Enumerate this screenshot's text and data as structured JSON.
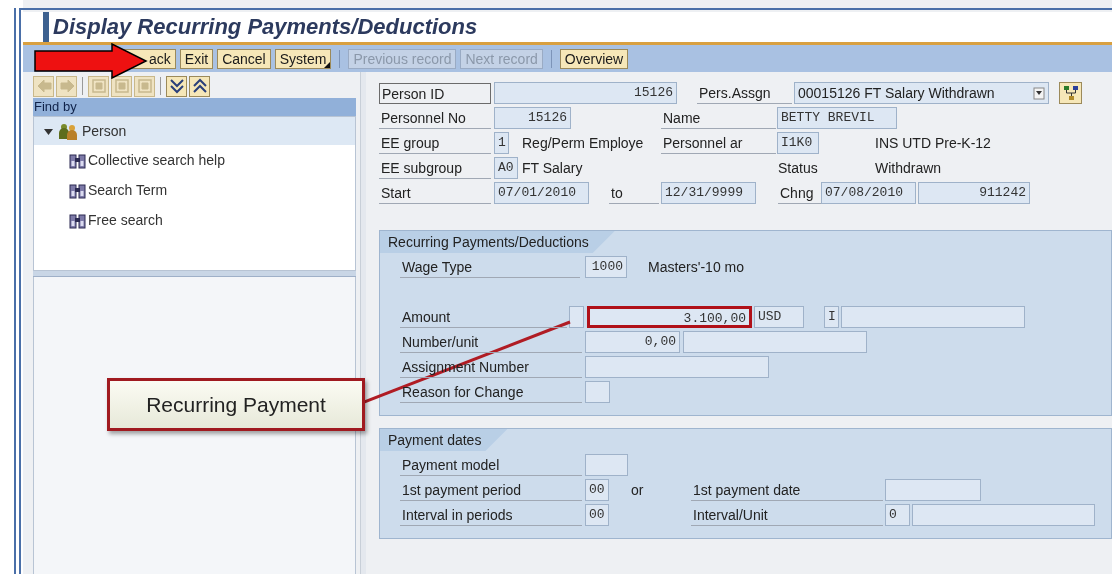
{
  "title": "Display Recurring Payments/Deductions",
  "toolbar": [
    {
      "label": "ack",
      "disabled": false,
      "menu": false
    },
    {
      "label": "Exit",
      "disabled": false,
      "menu": false
    },
    {
      "label": "Cancel",
      "disabled": false,
      "menu": false
    },
    {
      "label": "System",
      "disabled": false,
      "menu": true
    },
    {
      "label": "Previous record",
      "disabled": true,
      "menu": false
    },
    {
      "label": "Next record",
      "disabled": true,
      "menu": false
    },
    {
      "label": "Overview",
      "disabled": false,
      "menu": false
    }
  ],
  "nav_toolbar": [
    {
      "kind": "back",
      "disabled": true
    },
    {
      "kind": "forward",
      "disabled": true
    },
    {
      "kind": "grid",
      "disabled": true
    },
    {
      "kind": "grid",
      "disabled": true
    },
    {
      "kind": "grid",
      "disabled": true
    },
    {
      "kind": "expand",
      "disabled": false
    },
    {
      "kind": "collapse",
      "disabled": false
    }
  ],
  "nav_panel": {
    "title": "Find by",
    "tree": [
      {
        "label": "Person",
        "expanded": true,
        "children": [
          {
            "label": "Collective search help"
          },
          {
            "label": "Search Term"
          },
          {
            "label": "Free search"
          }
        ]
      }
    ]
  },
  "header": [
    [
      {
        "kind": "label",
        "text": "Person ID",
        "focused": true
      },
      {
        "kind": "field",
        "value": "15126"
      },
      {
        "kind": "label",
        "text": "Pers.Assgn"
      },
      {
        "kind": "dropdown",
        "value": "00015126 FT Salary Withdrawn"
      },
      {
        "kind": "icon_button"
      }
    ],
    [
      {
        "kind": "label",
        "text": "Personnel No"
      },
      {
        "kind": "field",
        "value": "15126"
      },
      {
        "kind": "label",
        "text": "Name"
      },
      {
        "kind": "field",
        "value": "BETTY  BREVIL"
      }
    ],
    [
      {
        "kind": "label",
        "text": "EE group"
      },
      {
        "kind": "field",
        "value": "1"
      },
      {
        "kind": "text",
        "text": "Reg/Perm Employe"
      },
      {
        "kind": "label",
        "text": "Personnel ar"
      },
      {
        "kind": "field",
        "value": "I1K0"
      },
      {
        "kind": "text",
        "text": "INS UTD Pre-K-12"
      }
    ],
    [
      {
        "kind": "label",
        "text": "EE subgroup"
      },
      {
        "kind": "field",
        "value": "A0"
      },
      {
        "kind": "text",
        "text": "FT Salary"
      },
      {
        "kind": "text",
        "text": "Status"
      },
      {
        "kind": "text",
        "text": "Withdrawn"
      }
    ],
    [
      {
        "kind": "label",
        "text": "Start"
      },
      {
        "kind": "field",
        "value": "07/01/2010"
      },
      {
        "kind": "label",
        "text": "to"
      },
      {
        "kind": "field",
        "value": "12/31/9999"
      },
      {
        "kind": "label",
        "text": "Chng"
      },
      {
        "kind": "field",
        "value": "07/08/2010"
      },
      {
        "kind": "field",
        "value": "911242"
      }
    ]
  ],
  "sections": [
    {
      "title": "Recurring Payments/Deductions",
      "rows": [
        [
          {
            "kind": "label",
            "text": "Wage Type"
          },
          {
            "kind": "field",
            "value": "1000"
          },
          {
            "kind": "text",
            "text": "Masters'-10 mo"
          }
        ],
        [],
        [
          {
            "kind": "label",
            "text": "Amount"
          },
          {
            "kind": "field"
          },
          {
            "kind": "field",
            "value": "3.100,00",
            "highlighted": true
          },
          {
            "kind": "field",
            "value": "USD"
          },
          {
            "kind": "field",
            "value": "I"
          },
          {
            "kind": "field"
          }
        ],
        [
          {
            "kind": "label",
            "text": "Number/unit"
          },
          {
            "kind": "field",
            "value": "0,00"
          },
          {
            "kind": "field"
          }
        ],
        [
          {
            "kind": "label",
            "text": "Assignment Number"
          },
          {
            "kind": "field"
          }
        ],
        [
          {
            "kind": "label",
            "text": "Reason for Change"
          },
          {
            "kind": "field"
          }
        ]
      ]
    },
    {
      "title": "Payment dates",
      "rows": [
        [
          {
            "kind": "label",
            "text": "Payment model"
          },
          {
            "kind": "field"
          }
        ],
        [
          {
            "kind": "label",
            "text": "1st payment period"
          },
          {
            "kind": "field",
            "value": "00"
          },
          {
            "kind": "text",
            "text": "or"
          },
          {
            "kind": "label",
            "text": "1st payment date"
          },
          {
            "kind": "field"
          }
        ],
        [
          {
            "kind": "label",
            "text": "Interval in periods"
          },
          {
            "kind": "field",
            "value": "00"
          },
          {
            "kind": "empty"
          },
          {
            "kind": "label",
            "text": "Interval/Unit"
          },
          {
            "kind": "field",
            "value": "0"
          },
          {
            "kind": "field"
          }
        ]
      ]
    }
  ],
  "callout": {
    "text": "Recurring Payment"
  }
}
